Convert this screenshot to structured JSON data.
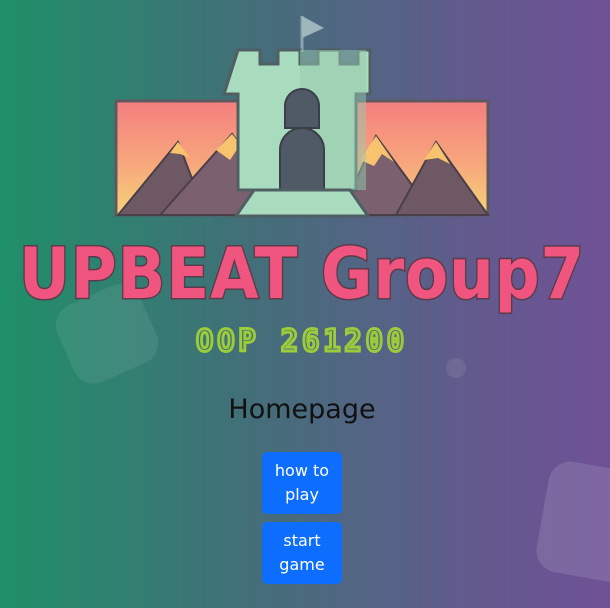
{
  "logo": {
    "title": "UPBEAT Group7",
    "subtitle": "OOP 261200",
    "icon": "castle-mountains-logo"
  },
  "page": {
    "heading": "Homepage"
  },
  "buttons": {
    "how_to_play": "how to play",
    "start_game": "start game"
  },
  "colors": {
    "primary_button": "#0d6efd",
    "title_pink": "#f0557f",
    "subtitle_green": "#9ccc3a",
    "castle_mint": "#a9dbbf"
  }
}
